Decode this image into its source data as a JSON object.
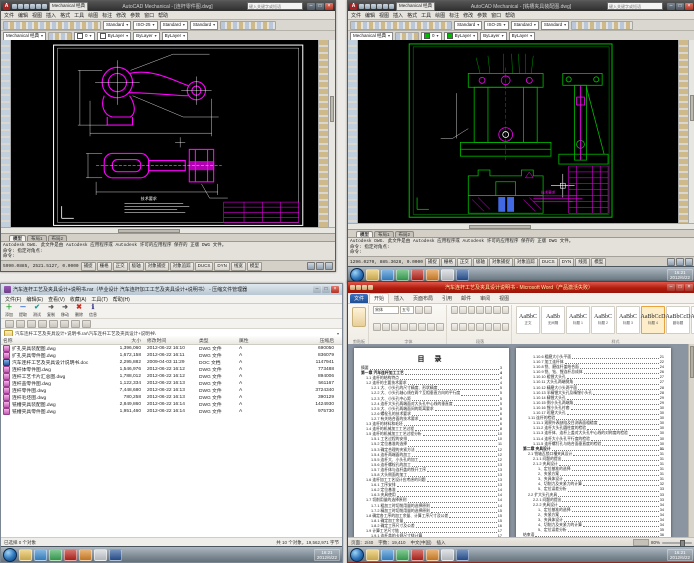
{
  "cad_left": {
    "workspace": "Mechanical 经典",
    "title": "AutoCAD Mechanical - [连杆零件图.dwg]",
    "menus": [
      "文件",
      "编辑",
      "视图",
      "插入",
      "格式",
      "工具",
      "绘图",
      "标注",
      "修改",
      "参数",
      "窗口",
      "帮助"
    ],
    "style_dropdowns": [
      "Standard",
      "ISO-25",
      "Standard",
      "Standard"
    ],
    "layer_value": "0",
    "bylayer": [
      "ByLayer",
      "ByLayer",
      "ByLayer",
      "ByColor"
    ],
    "infocenter_placeholder": "键入关键字或短语",
    "layout_tabs": [
      "模型",
      "布局1",
      "布局2"
    ],
    "command_lines": [
      "Autodesk DWG. 此文件是由 Autodesk 应用程序或 Autodesk 许可的应用程序 保存的 正版 DWG 文件。",
      "命令: 指定对角点:",
      "命令:"
    ],
    "status_coords": "5990.0885, 2521.5127, 0.0000",
    "status_buttons": [
      "捕捉",
      "栅格",
      "正交",
      "极轴",
      "对象捕捉",
      "对象追踪",
      "DUCS",
      "DYN",
      "线宽",
      "模型"
    ],
    "notes_title": "技术要求",
    "drawing_colors": {
      "part": "#ff00ff",
      "dims": "#ffffff"
    }
  },
  "cad_right": {
    "workspace": "Mechanical 经典",
    "title": "AutoCAD Mechanical - [铣槽夹具装配图.dwg]",
    "menus": [
      "文件",
      "编辑",
      "视图",
      "插入",
      "格式",
      "工具",
      "绘图",
      "标注",
      "修改",
      "参数",
      "窗口",
      "帮助"
    ],
    "style_dropdowns": [
      "Standard",
      "ISO-25",
      "Standard",
      "Standard"
    ],
    "layer_value": "0",
    "bylayer": [
      "ByLayer",
      "ByLayer",
      "ByLayer",
      "ByColor"
    ],
    "infocenter_placeholder": "键入关键字或短语",
    "layout_tabs": [
      "模型",
      "布局1",
      "布局2"
    ],
    "command_lines": [
      "Autodesk DWG. 此文件是由 Autodesk 应用程序或 Autodesk 许可的应用程序 保存的 正版 DWG 文件。",
      "命令: 指定对角点:",
      "命令:"
    ],
    "status_coords": "1296.0270, 885.3628, 0.0000",
    "status_buttons": [
      "捕捉",
      "栅格",
      "正交",
      "极轴",
      "对象捕捉",
      "对象追踪",
      "DUCS",
      "DYN",
      "线宽",
      "模型"
    ],
    "notes_title": "技术要求",
    "drawing_colors": {
      "frame": "#00bf00",
      "part": "#ff00ff",
      "detail": "#4169e1"
    }
  },
  "archive": {
    "title": "汽车连杆工艺及夹具设计+说明书.rar（毕业设计 汽车连杆加工工艺及夹具设计+说明书） - 压缩文件管理器",
    "menus": [
      "文件(F)",
      "编辑(E)",
      "查看(V)",
      "收藏(A)",
      "工具(T)",
      "帮助(H)"
    ],
    "tools": [
      {
        "glyph": "＋",
        "color": "#1f9e2c",
        "label": "添加"
      },
      {
        "glyph": "－",
        "color": "#1f5fd0",
        "label": "提取"
      },
      {
        "glyph": "✔",
        "color": "#0f9e9e",
        "label": "测试"
      },
      {
        "glyph": "➜",
        "color": "#555555",
        "label": "复制"
      },
      {
        "glyph": "➜",
        "color": "#555555",
        "label": "移动"
      },
      {
        "glyph": "✖",
        "color": "#d02a1f",
        "label": "删除"
      },
      {
        "glyph": "ℹ",
        "color": "#3a3a8c",
        "label": "信息"
      }
    ],
    "address": "汽车连杆工艺及夹具设计+说明书.rar\\汽车连杆工艺及夹具设计+说明书\\",
    "columns": [
      "名称",
      "大小",
      "修改时间",
      "类型",
      "属性",
      "压缩后"
    ],
    "files": [
      {
        "name": "扩孔夹具装配图.dwg",
        "size": "1,396,060",
        "date": "2012-06-22 16:10",
        "type": "DWG 文件",
        "attr": "A",
        "packed": "690050",
        "doc": false
      },
      {
        "name": "扩孔夹具零件图.dwg",
        "size": "1,672,158",
        "date": "2012-06-22 16:11",
        "type": "DWG 文件",
        "attr": "A",
        "packed": "836079",
        "doc": false
      },
      {
        "name": "汽车连杆工艺及夹具设计说明书.doc",
        "size": "2,295,882",
        "date": "2009-04-03 11:29",
        "type": "DOC 文档",
        "attr": "A",
        "packed": "1147941",
        "doc": true
      },
      {
        "name": "连杆体零件图.dwg",
        "size": "1,546,976",
        "date": "2012-06-22 16:12",
        "type": "DWG 文件",
        "attr": "A",
        "packed": "773488",
        "doc": false
      },
      {
        "name": "连杆工艺卡片汇总图.dwg",
        "size": "1,788,012",
        "date": "2012-06-22 16:12",
        "type": "DWG 文件",
        "attr": "A",
        "packed": "894006",
        "doc": false
      },
      {
        "name": "连杆盖零件图.dwg",
        "size": "1,122,334",
        "date": "2012-06-22 16:13",
        "type": "DWG 文件",
        "attr": "A",
        "packed": "561167",
        "doc": false
      },
      {
        "name": "连杆零件图.dwg",
        "size": "7,448,680",
        "date": "2012-06-22 16:13",
        "type": "DWG 文件",
        "attr": "A",
        "packed": "3724340",
        "doc": false
      },
      {
        "name": "连杆毛坯图.dwg",
        "size": "780,258",
        "date": "2012-06-22 16:13",
        "type": "DWG 文件",
        "attr": "A",
        "packed": "390129",
        "doc": false
      },
      {
        "name": "铣槽夹具装配图.dwg",
        "size": "2,849,860",
        "date": "2012-06-22 16:14",
        "type": "DWG 文件",
        "attr": "A",
        "packed": "1424930",
        "doc": false
      },
      {
        "name": "铣槽夹具零件图.dwg",
        "size": "1,951,460",
        "date": "2012-06-22 16:14",
        "type": "DWG 文件",
        "attr": "A",
        "packed": "975730",
        "doc": false
      }
    ],
    "status_left": "已选择 0 个对象",
    "status_right": "共 10 个对象，19,562,971 字节"
  },
  "word": {
    "title": "汽车连杆工艺及夹具设计说明书 - Microsoft Word（产品激活失败）",
    "tabs": [
      "文件",
      "开始",
      "插入",
      "页面布局",
      "引用",
      "邮件",
      "审阅",
      "视图"
    ],
    "font_name": "宋体",
    "font_size": "五号",
    "group_labels": [
      "剪贴板",
      "字体",
      "段落",
      "样式",
      "编辑"
    ],
    "edit_items": [
      "查找",
      "替换",
      "选择"
    ],
    "style_chips": [
      {
        "pv": "AaBbC",
        "lb": "正文",
        "hl": false
      },
      {
        "pv": "AaBb",
        "lb": "无间隔",
        "hl": false
      },
      {
        "pv": "AaBbC",
        "lb": "标题 1",
        "hl": false
      },
      {
        "pv": "AaBbC",
        "lb": "标题 2",
        "hl": false
      },
      {
        "pv": "AaBbC",
        "lb": "标题 3",
        "hl": false
      },
      {
        "pv": "AaBbCcD",
        "lb": "标题 4",
        "hl": true
      },
      {
        "pv": "AaBbCcD",
        "lb": "副标题",
        "hl": false
      },
      {
        "pv": "AaBbCcD",
        "lb": "强调",
        "hl": false
      }
    ],
    "change_style_label": "更改样式",
    "toc_title": "目  录",
    "toc_left": [
      {
        "t": "摘要",
        "p": "3",
        "i": 0,
        "b": false
      },
      {
        "t": "第一章  汽车连杆加工工艺",
        "p": "4",
        "i": 0,
        "b": true
      },
      {
        "t": "1.1 连杆的结构特点",
        "p": "4",
        "i": 1,
        "b": false
      },
      {
        "t": "1.2 连杆的主要技术要求",
        "p": "4",
        "i": 1,
        "b": false
      },
      {
        "t": "1.2.1 大、小头孔的尺寸精度、形状精度",
        "p": "5",
        "i": 2,
        "b": false
      },
      {
        "t": "1.2.2 大、小头孔轴心线在两个互相垂直方向的平行度",
        "p": "5",
        "i": 2,
        "b": false
      },
      {
        "t": "1.2.3 大、小头孔中心距",
        "p": "5",
        "i": 2,
        "b": false
      },
      {
        "t": "1.2.4 连杆大头孔两端面对大头孔中心线的垂直度",
        "p": "5",
        "i": 2,
        "b": false
      },
      {
        "t": "1.2.5 大、小头孔两端面间的距离要求",
        "p": "5",
        "i": 2,
        "b": false
      },
      {
        "t": "1.2.6 螺栓孔的技术要求",
        "p": "6",
        "i": 2,
        "b": false
      },
      {
        "t": "1.2.7 有关结合面的技术要求",
        "p": "6",
        "i": 2,
        "b": false
      },
      {
        "t": "1.3 连杆的材料和毛坯",
        "p": "6",
        "i": 1,
        "b": false
      },
      {
        "t": "1.4 连杆的机械加工工艺过程",
        "p": "8",
        "i": 1,
        "b": false
      },
      {
        "t": "1.5 连杆的机械加工工艺过程分析",
        "p": "10",
        "i": 1,
        "b": false
      },
      {
        "t": "1.5.1 工艺过程的安排",
        "p": "10",
        "i": 2,
        "b": false
      },
      {
        "t": "1.5.2 定位基准的选择",
        "p": "11",
        "i": 2,
        "b": false
      },
      {
        "t": "1.5.3 确定合理的夹紧方法",
        "p": "12",
        "i": 2,
        "b": false
      },
      {
        "t": "1.5.4 连杆两端面的加工",
        "p": "12",
        "i": 2,
        "b": false
      },
      {
        "t": "1.5.5 连杆大、小头孔的加工",
        "p": "12",
        "i": 2,
        "b": false
      },
      {
        "t": "1.5.6 连杆螺栓孔的加工",
        "p": "13",
        "i": 2,
        "b": false
      },
      {
        "t": "1.5.7 连杆体与连杆盖的铣开工序",
        "p": "13",
        "i": 2,
        "b": false
      },
      {
        "t": "1.5.8 大头侧面的加工",
        "p": "13",
        "i": 2,
        "b": false
      },
      {
        "t": "1.6 连杆加工工艺设计应考虑的问题",
        "p": "13",
        "i": 1,
        "b": false
      },
      {
        "t": "1.6.1 工序安排",
        "p": "13",
        "i": 2,
        "b": false
      },
      {
        "t": "1.6.2 定位基准",
        "p": "14",
        "i": 2,
        "b": false
      },
      {
        "t": "1.6.3 夹具使用",
        "p": "14",
        "i": 2,
        "b": false
      },
      {
        "t": "1.7 切削用量的选择原则",
        "p": "14",
        "i": 1,
        "b": false
      },
      {
        "t": "1.7.1 粗加工时切削用量的选择原则",
        "p": "14",
        "i": 2,
        "b": false
      },
      {
        "t": "1.7.2 精加工时切削用量的选择原则",
        "p": "15",
        "i": 2,
        "b": false
      },
      {
        "t": "1.8 确定各工序的加工余量、计算工序尺寸及公差",
        "p": "15",
        "i": 1,
        "b": false
      },
      {
        "t": "1.8.1 确定加工余量",
        "p": "15",
        "i": 2,
        "b": false
      },
      {
        "t": "1.8.2 确定工序尺寸及公差",
        "p": "16",
        "i": 2,
        "b": false
      },
      {
        "t": "1.9 计算工艺尺寸链",
        "p": "17",
        "i": 1,
        "b": false
      },
      {
        "t": "1.9.1 连杆盖的卡规尺寸链计算",
        "p": "17",
        "i": 2,
        "b": false
      },
      {
        "t": "1.9.2 连杆体的卡规尺寸链计算",
        "p": "18",
        "i": 2,
        "b": false
      },
      {
        "t": "1.10 工时定额的计算",
        "p": "18",
        "i": 1,
        "b": false
      }
    ],
    "toc_right": [
      {
        "t": "1.10.6 粗磨大小头平面",
        "p": "21",
        "i": 2,
        "b": false
      },
      {
        "t": "1.10.7 加工连杆体",
        "p": "22",
        "i": 2,
        "b": false
      },
      {
        "t": "1.10.8 铣、磨连杆盖结合面",
        "p": "24",
        "i": 2,
        "b": false
      },
      {
        "t": "1.10.9 铣、钻、镗连杆总成体",
        "p": "26",
        "i": 2,
        "b": false
      },
      {
        "t": "1.10.10 粗镗大头孔",
        "p": "27",
        "i": 2,
        "b": false
      },
      {
        "t": "1.10.11 大头孔两端倒角",
        "p": "27",
        "i": 2,
        "b": false
      },
      {
        "t": "1.10.12 精磨大小头两平面",
        "p": "28",
        "i": 2,
        "b": false
      },
      {
        "t": "1.10.13 半精镗大头孔及精镗小头孔",
        "p": "28",
        "i": 2,
        "b": false
      },
      {
        "t": "1.10.14 精镗大头孔",
        "p": "29",
        "i": 2,
        "b": false
      },
      {
        "t": "1.10.15 倒小头孔两端角",
        "p": "29",
        "i": 2,
        "b": false
      },
      {
        "t": "1.10.16 镗小头孔衬套",
        "p": "30",
        "i": 2,
        "b": false
      },
      {
        "t": "1.10.17 珩磨大头孔",
        "p": "30",
        "i": 2,
        "b": false
      },
      {
        "t": "1.11 连杆的检验",
        "p": "30",
        "i": 1,
        "b": false
      },
      {
        "t": "1.11.1 观察外表缺陷及目测表面粗糙度",
        "p": "30",
        "i": 2,
        "b": false
      },
      {
        "t": "1.11.2 连杆大头孔圆柱度的检验",
        "p": "30",
        "i": 2,
        "b": false
      },
      {
        "t": "1.11.3 连杆体、连杆上盖对大头孔中心线的对称度的检验",
        "p": "30",
        "i": 2,
        "b": false
      },
      {
        "t": "1.11.4 连杆大小头孔平行度的检验",
        "p": "30",
        "i": 2,
        "b": false
      },
      {
        "t": "1.11.5 连杆螺钉孔与结合面垂直度的检验",
        "p": "30",
        "i": 2,
        "b": false
      },
      {
        "t": "第二章  夹具设计",
        "p": "31",
        "i": 0,
        "b": true
      },
      {
        "t": "2.1 铣轴瓦锁口槽夹具设计",
        "p": "31",
        "i": 1,
        "b": false
      },
      {
        "t": "2.1.1 问题的提出",
        "p": "31",
        "i": 2,
        "b": false
      },
      {
        "t": "2.1.2 夹具设计",
        "p": "31",
        "i": 2,
        "b": false
      },
      {
        "t": "1、定位基准的选择",
        "p": "31",
        "i": 3,
        "b": false
      },
      {
        "t": "2、夹紧方案",
        "p": "31",
        "i": 3,
        "b": false
      },
      {
        "t": "3、夹具体设计",
        "p": "31",
        "i": 3,
        "b": false
      },
      {
        "t": "4、切削力及夹紧力的计算",
        "p": "32",
        "i": 3,
        "b": false
      },
      {
        "t": "5、定位误差分析",
        "p": "33",
        "i": 3,
        "b": false
      },
      {
        "t": "2.2 扩大头孔夹具",
        "p": "33",
        "i": 1,
        "b": false
      },
      {
        "t": "2.2.1 问题的提出",
        "p": "33",
        "i": 2,
        "b": false
      },
      {
        "t": "2.2.2 夹具设计",
        "p": "34",
        "i": 2,
        "b": false
      },
      {
        "t": "1、定位基准的选择",
        "p": "34",
        "i": 3,
        "b": false
      },
      {
        "t": "2、夹紧方案",
        "p": "34",
        "i": 3,
        "b": false
      },
      {
        "t": "3、夹具体设计",
        "p": "34",
        "i": 3,
        "b": false
      },
      {
        "t": "4、切削力及夹紧力的计算",
        "p": "34",
        "i": 3,
        "b": false
      },
      {
        "t": "5、定位误差分析",
        "p": "35",
        "i": 3,
        "b": false
      },
      {
        "t": "结束语",
        "p": "36",
        "i": 0,
        "b": false
      },
      {
        "t": "参考文献",
        "p": "37",
        "i": 0,
        "b": false
      },
      {
        "t": "致谢",
        "p": "38",
        "i": 0,
        "b": false
      },
      {
        "t": "毕业设计(论文)成果书",
        "p": "39",
        "i": 0,
        "b": false
      }
    ],
    "status_items": [
      "页面：2/40",
      "字数：19,410",
      "中文(中国)",
      "插入"
    ],
    "zoom_level": "80%"
  },
  "taskbar": {
    "icons": [
      {
        "name": "explorer",
        "color": "#e8c35a"
      },
      {
        "name": "ie",
        "color": "#3f8fd6"
      },
      {
        "name": "autocad",
        "color": "#3fae5a"
      },
      {
        "name": "acrobat",
        "color": "#c0281e"
      },
      {
        "name": "archive",
        "color": "#e08a2d"
      },
      {
        "name": "notepad",
        "color": "#cfd4d9"
      },
      {
        "name": "word",
        "color": "#2b579a"
      }
    ],
    "time": "16:21",
    "date": "2012/6/22"
  }
}
